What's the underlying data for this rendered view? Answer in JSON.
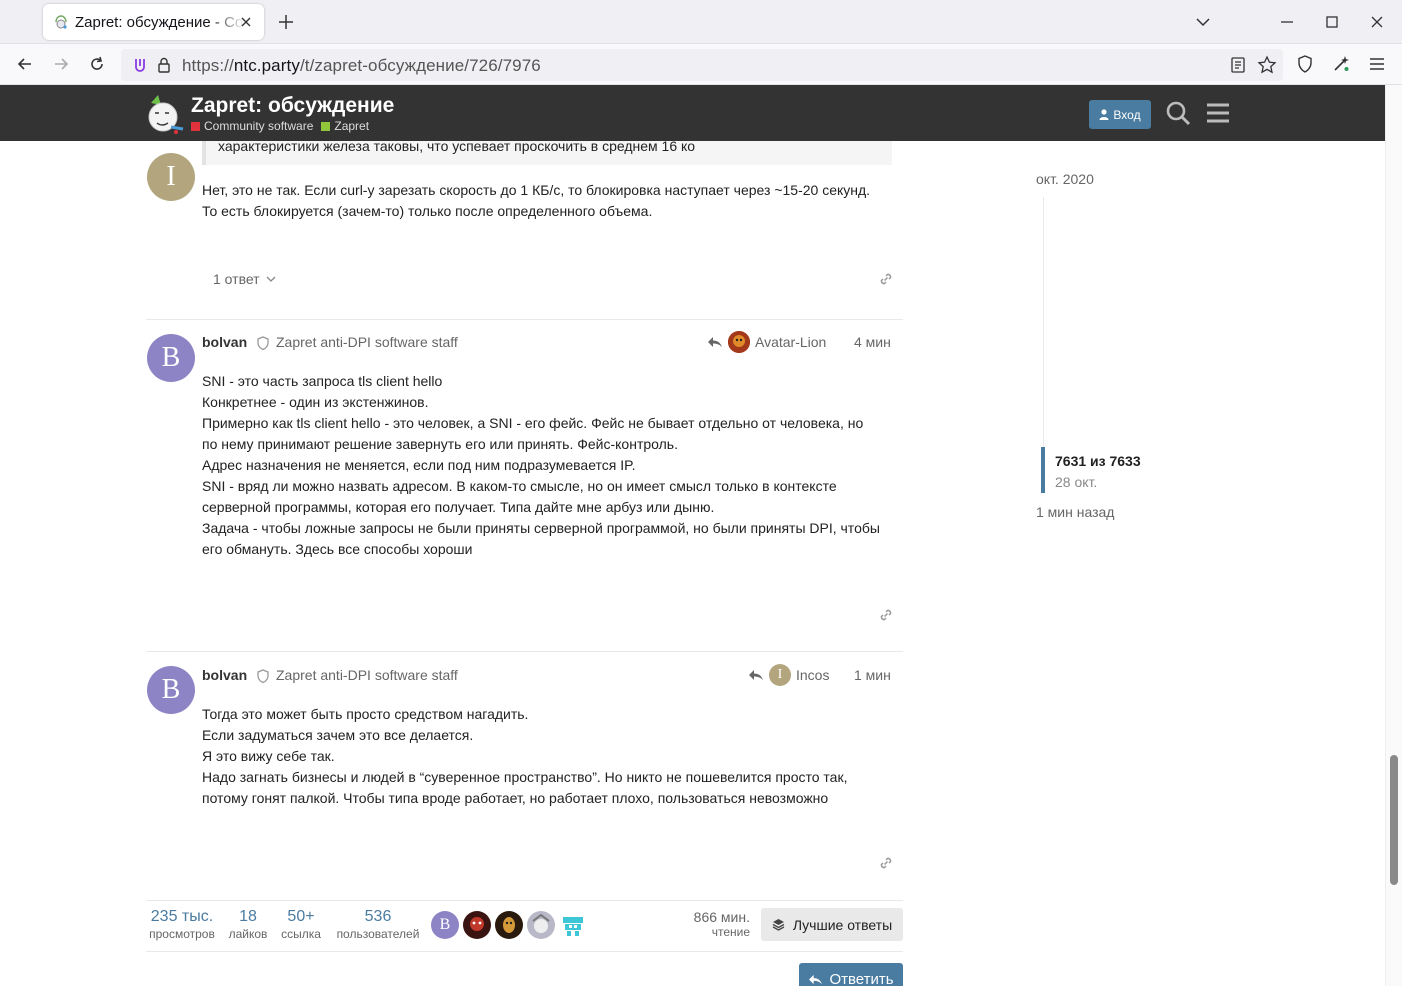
{
  "browser": {
    "tab_title": "Zapret: обсуждение - Community software",
    "url_prefix": "https://",
    "url_host": "ntc.party",
    "url_path": "/t/zapret-обсуждение/726/7976"
  },
  "header": {
    "title": "Zapret: обсуждение",
    "crumbs": [
      {
        "label": "Community software",
        "color": "#e1333b"
      },
      {
        "label": "Zapret",
        "color": "#92c73b"
      }
    ],
    "login_label": "Вход"
  },
  "posts": [
    {
      "quote": "характеристики железа таковы, что успевает проскочить в среднем 16 ко",
      "avatar_letter": "I",
      "avatar_color": "#b3a67f",
      "lines": [
        "Нет, это не так. Если curl-у зарезать скорость до 1 КБ/с, то блокировка наступает через ~15-20 секунд.",
        "То есть блокируется (зачем-то) только после определенного объема."
      ],
      "replies_label": "1 ответ"
    },
    {
      "username": "bolvan",
      "user_title": "Zapret anti-DPI software staff",
      "avatar_letter": "B",
      "avatar_color": "#8c84c4",
      "reply_to": "Avatar-Lion",
      "date": "4 мин",
      "lines": [
        "SNI - это часть запроса tls client hello",
        "Конкретнее - один из экстенжинов.",
        "Примерно как tls client hello - это человек, а SNI - его фейс. Фейс не бывает отдельно от человека, но",
        "по нему принимают решение завернуть его или принять. Фейс-контроль.",
        "Адрес назначения не меняется, если под ним подразумевается IP.",
        "SNI - вряд ли можно назвать адресом. В каком-то смысле, но он имеет смысл только в контексте",
        "серверной программы, которая его получает. Типа дайте мне арбуз или дыню.",
        "Задача - чтобы ложные запросы не были приняты серверной программой, но были приняты DPI, чтобы",
        "его обмануть. Здесь все способы хороши"
      ]
    },
    {
      "username": "bolvan",
      "user_title": "Zapret anti-DPI software staff",
      "avatar_letter": "B",
      "avatar_color": "#8c84c4",
      "reply_to": "Incos",
      "reply_to_letter": "I",
      "reply_to_color": "#b3a67f",
      "date": "1 мин",
      "lines": [
        "Тогда это может быть просто средством нагадить.",
        "Если задуматься зачем это все делается.",
        "Я это вижу себе так.",
        "Надо загнать бизнесы и людей в “суверенное пространство”. Но никто не пошевелится просто так,",
        "потому гонят палкой. Чтобы типа вроде работает, но работает плохо, пользоваться невозможно"
      ]
    }
  ],
  "topic_map": {
    "stats": [
      {
        "num": "235 тыс.",
        "label": "просмотров"
      },
      {
        "num": "18",
        "label": "лайков"
      },
      {
        "num": "50+",
        "label": "ссылка"
      },
      {
        "num": "536",
        "label": "пользователей"
      }
    ],
    "participant_letter": "B",
    "read_time": "866 мин.",
    "read_label": "чтение",
    "best_label": "Лучшие ответы"
  },
  "reply_button": "Ответить",
  "timeline": {
    "top_date": "окт. 2020",
    "position": "7631 из 7633",
    "position_date": "28 окт.",
    "bottom_date": "1 мин назад"
  }
}
